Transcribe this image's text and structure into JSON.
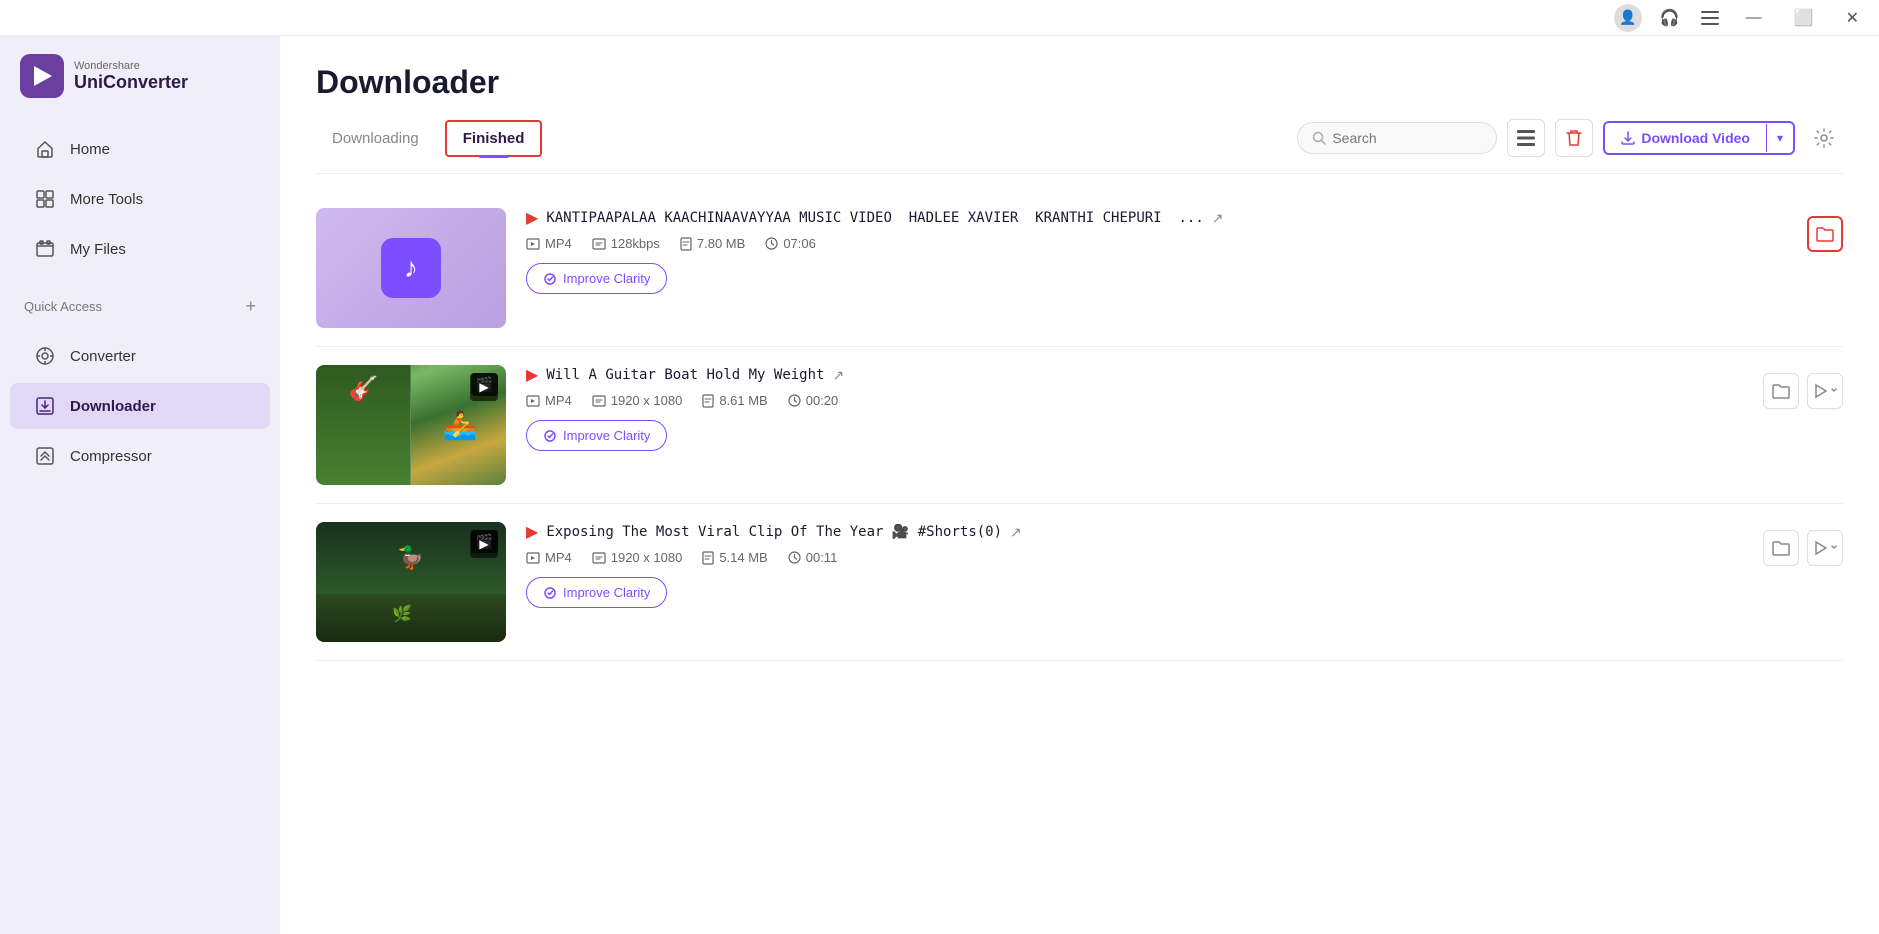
{
  "titlebar": {
    "avatar_icon": "👤",
    "headphones_icon": "🎧",
    "menu_icon": "☰",
    "minimize_icon": "—",
    "maximize_icon": "⬜",
    "close_icon": "✕"
  },
  "sidebar": {
    "brand": "Wondershare",
    "name": "UniConverter",
    "nav_items": [
      {
        "id": "home",
        "label": "Home",
        "icon": "home"
      },
      {
        "id": "more-tools",
        "label": "More Tools",
        "icon": "more-tools"
      },
      {
        "id": "my-files",
        "label": "My Files",
        "icon": "my-files"
      }
    ],
    "quick_access_label": "Quick Access",
    "quick_access_plus": "+",
    "sub_nav_items": [
      {
        "id": "converter",
        "label": "Converter",
        "icon": "converter"
      },
      {
        "id": "downloader",
        "label": "Downloader",
        "icon": "downloader",
        "active": true
      },
      {
        "id": "compressor",
        "label": "Compressor",
        "icon": "compressor"
      }
    ]
  },
  "page": {
    "title": "Downloader",
    "tabs": [
      {
        "id": "downloading",
        "label": "Downloading",
        "active": false
      },
      {
        "id": "finished",
        "label": "Finished",
        "active": true
      }
    ],
    "search_placeholder": "Search",
    "download_video_label": "Download Video",
    "improve_clarity_label": "Improve Clarity"
  },
  "videos": [
    {
      "id": "v1",
      "title": "KANTIPAAPALAA KAACHINAAVAYYAA MUSIC VIDEO  HADLEE XAVIER  KRANTHI CHEPURI  ...",
      "format": "MP4",
      "bitrate": "128kbps",
      "size": "7.80 MB",
      "duration": "07:06",
      "type": "audio",
      "thumbnail_type": "music"
    },
    {
      "id": "v2",
      "title": "Will A Guitar Boat Hold My Weight",
      "format": "MP4",
      "resolution": "1920 x 1080",
      "size": "8.61 MB",
      "duration": "00:20",
      "type": "video",
      "thumbnail_type": "outdoor1"
    },
    {
      "id": "v3",
      "title": "Exposing The Most Viral Clip Of The Year 🎥 #Shorts(0)",
      "format": "MP4",
      "resolution": "1920 x 1080",
      "size": "5.14 MB",
      "duration": "00:11",
      "type": "video",
      "thumbnail_type": "outdoor2"
    }
  ]
}
